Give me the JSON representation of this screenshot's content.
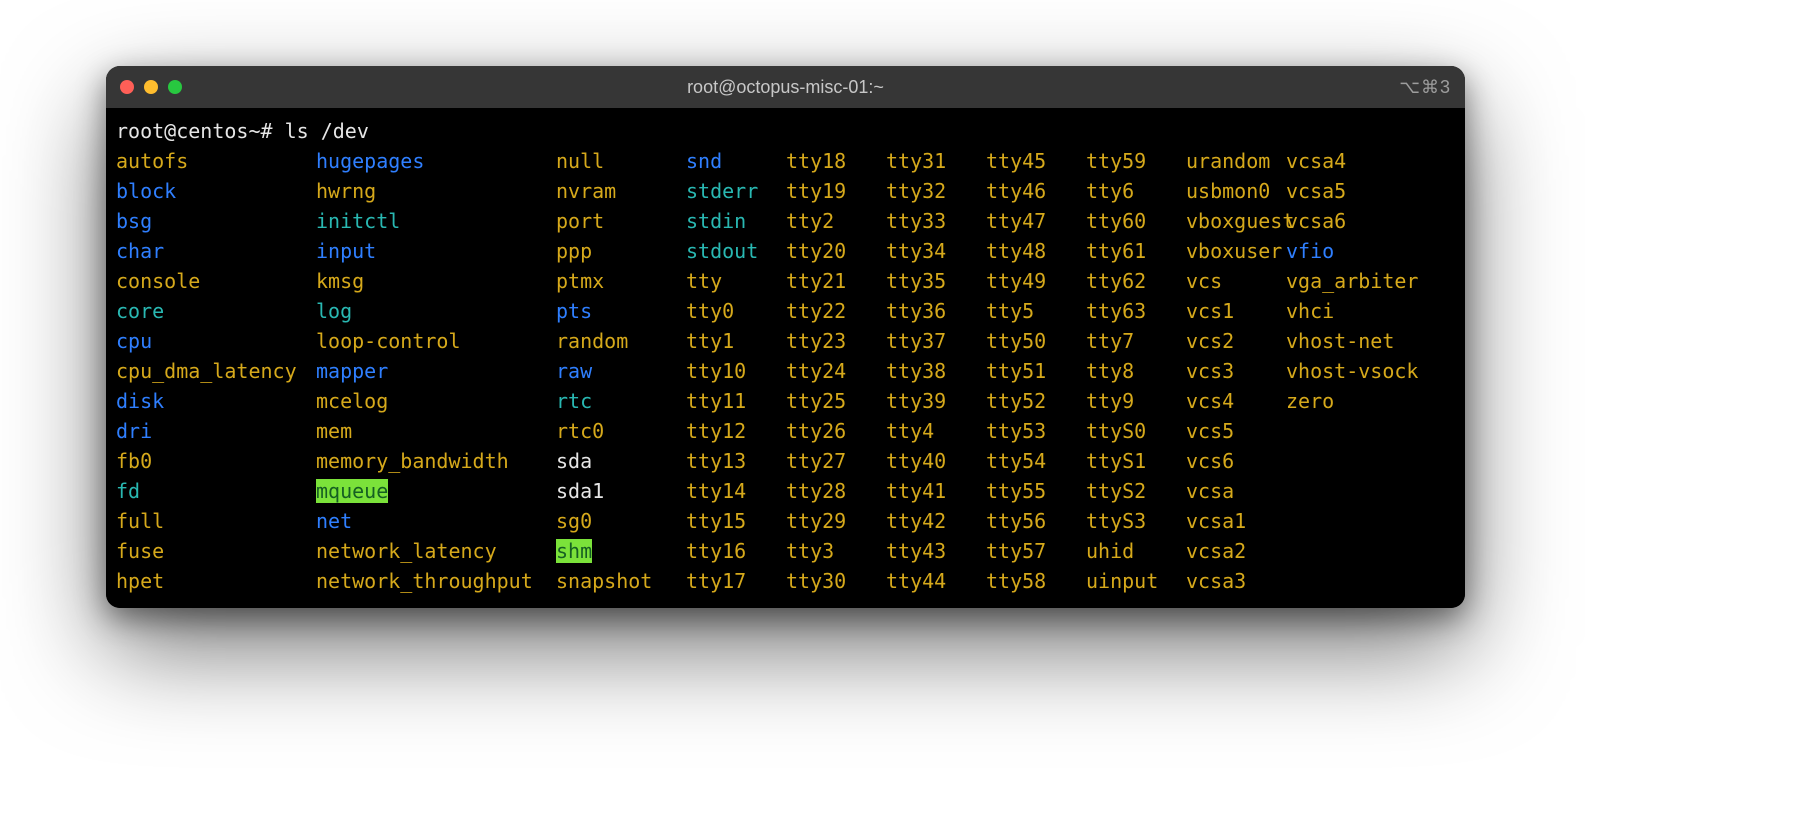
{
  "title": "root@octopus-misc-01:~",
  "title_right": "⌥⌘3",
  "prompt": "root@centos~# ls /dev",
  "columns": [
    [
      {
        "t": "autofs",
        "c": "yellow"
      },
      {
        "t": "block",
        "c": "blue"
      },
      {
        "t": "bsg",
        "c": "blue"
      },
      {
        "t": "char",
        "c": "blue"
      },
      {
        "t": "console",
        "c": "yellow"
      },
      {
        "t": "core",
        "c": "cyan"
      },
      {
        "t": "cpu",
        "c": "blue"
      },
      {
        "t": "cpu_dma_latency",
        "c": "yellow"
      },
      {
        "t": "disk",
        "c": "blue"
      },
      {
        "t": "dri",
        "c": "blue"
      },
      {
        "t": "fb0",
        "c": "yellow"
      },
      {
        "t": "fd",
        "c": "cyan"
      },
      {
        "t": "full",
        "c": "yellow"
      },
      {
        "t": "fuse",
        "c": "yellow"
      },
      {
        "t": "hpet",
        "c": "yellow"
      }
    ],
    [
      {
        "t": "hugepages",
        "c": "blue"
      },
      {
        "t": "hwrng",
        "c": "yellow"
      },
      {
        "t": "initctl",
        "c": "cyan"
      },
      {
        "t": "input",
        "c": "blue"
      },
      {
        "t": "kmsg",
        "c": "yellow"
      },
      {
        "t": "log",
        "c": "cyan"
      },
      {
        "t": "loop-control",
        "c": "yellow"
      },
      {
        "t": "mapper",
        "c": "blue"
      },
      {
        "t": "mcelog",
        "c": "yellow"
      },
      {
        "t": "mem",
        "c": "yellow"
      },
      {
        "t": "memory_bandwidth",
        "c": "yellow"
      },
      {
        "t": "mqueue",
        "c": "bgreen"
      },
      {
        "t": "net",
        "c": "blue"
      },
      {
        "t": "network_latency",
        "c": "yellow"
      },
      {
        "t": "network_throughput",
        "c": "yellow"
      }
    ],
    [
      {
        "t": "null",
        "c": "yellow"
      },
      {
        "t": "nvram",
        "c": "yellow"
      },
      {
        "t": "port",
        "c": "yellow"
      },
      {
        "t": "ppp",
        "c": "yellow"
      },
      {
        "t": "ptmx",
        "c": "yellow"
      },
      {
        "t": "pts",
        "c": "blue"
      },
      {
        "t": "random",
        "c": "yellow"
      },
      {
        "t": "raw",
        "c": "blue"
      },
      {
        "t": "rtc",
        "c": "cyan"
      },
      {
        "t": "rtc0",
        "c": "yellow"
      },
      {
        "t": "sda",
        "c": "white"
      },
      {
        "t": "sda1",
        "c": "white"
      },
      {
        "t": "sg0",
        "c": "yellow"
      },
      {
        "t": "shm",
        "c": "bgreen"
      },
      {
        "t": "snapshot",
        "c": "yellow"
      }
    ],
    [
      {
        "t": "snd",
        "c": "blue"
      },
      {
        "t": "stderr",
        "c": "cyan"
      },
      {
        "t": "stdin",
        "c": "cyan"
      },
      {
        "t": "stdout",
        "c": "cyan"
      },
      {
        "t": "tty",
        "c": "yellow"
      },
      {
        "t": "tty0",
        "c": "yellow"
      },
      {
        "t": "tty1",
        "c": "yellow"
      },
      {
        "t": "tty10",
        "c": "yellow"
      },
      {
        "t": "tty11",
        "c": "yellow"
      },
      {
        "t": "tty12",
        "c": "yellow"
      },
      {
        "t": "tty13",
        "c": "yellow"
      },
      {
        "t": "tty14",
        "c": "yellow"
      },
      {
        "t": "tty15",
        "c": "yellow"
      },
      {
        "t": "tty16",
        "c": "yellow"
      },
      {
        "t": "tty17",
        "c": "yellow"
      }
    ],
    [
      {
        "t": "tty18",
        "c": "yellow"
      },
      {
        "t": "tty19",
        "c": "yellow"
      },
      {
        "t": "tty2",
        "c": "yellow"
      },
      {
        "t": "tty20",
        "c": "yellow"
      },
      {
        "t": "tty21",
        "c": "yellow"
      },
      {
        "t": "tty22",
        "c": "yellow"
      },
      {
        "t": "tty23",
        "c": "yellow"
      },
      {
        "t": "tty24",
        "c": "yellow"
      },
      {
        "t": "tty25",
        "c": "yellow"
      },
      {
        "t": "tty26",
        "c": "yellow"
      },
      {
        "t": "tty27",
        "c": "yellow"
      },
      {
        "t": "tty28",
        "c": "yellow"
      },
      {
        "t": "tty29",
        "c": "yellow"
      },
      {
        "t": "tty3",
        "c": "yellow"
      },
      {
        "t": "tty30",
        "c": "yellow"
      }
    ],
    [
      {
        "t": "tty31",
        "c": "yellow"
      },
      {
        "t": "tty32",
        "c": "yellow"
      },
      {
        "t": "tty33",
        "c": "yellow"
      },
      {
        "t": "tty34",
        "c": "yellow"
      },
      {
        "t": "tty35",
        "c": "yellow"
      },
      {
        "t": "tty36",
        "c": "yellow"
      },
      {
        "t": "tty37",
        "c": "yellow"
      },
      {
        "t": "tty38",
        "c": "yellow"
      },
      {
        "t": "tty39",
        "c": "yellow"
      },
      {
        "t": "tty4",
        "c": "yellow"
      },
      {
        "t": "tty40",
        "c": "yellow"
      },
      {
        "t": "tty41",
        "c": "yellow"
      },
      {
        "t": "tty42",
        "c": "yellow"
      },
      {
        "t": "tty43",
        "c": "yellow"
      },
      {
        "t": "tty44",
        "c": "yellow"
      }
    ],
    [
      {
        "t": "tty45",
        "c": "yellow"
      },
      {
        "t": "tty46",
        "c": "yellow"
      },
      {
        "t": "tty47",
        "c": "yellow"
      },
      {
        "t": "tty48",
        "c": "yellow"
      },
      {
        "t": "tty49",
        "c": "yellow"
      },
      {
        "t": "tty5",
        "c": "yellow"
      },
      {
        "t": "tty50",
        "c": "yellow"
      },
      {
        "t": "tty51",
        "c": "yellow"
      },
      {
        "t": "tty52",
        "c": "yellow"
      },
      {
        "t": "tty53",
        "c": "yellow"
      },
      {
        "t": "tty54",
        "c": "yellow"
      },
      {
        "t": "tty55",
        "c": "yellow"
      },
      {
        "t": "tty56",
        "c": "yellow"
      },
      {
        "t": "tty57",
        "c": "yellow"
      },
      {
        "t": "tty58",
        "c": "yellow"
      }
    ],
    [
      {
        "t": "tty59",
        "c": "yellow"
      },
      {
        "t": "tty6",
        "c": "yellow"
      },
      {
        "t": "tty60",
        "c": "yellow"
      },
      {
        "t": "tty61",
        "c": "yellow"
      },
      {
        "t": "tty62",
        "c": "yellow"
      },
      {
        "t": "tty63",
        "c": "yellow"
      },
      {
        "t": "tty7",
        "c": "yellow"
      },
      {
        "t": "tty8",
        "c": "yellow"
      },
      {
        "t": "tty9",
        "c": "yellow"
      },
      {
        "t": "ttyS0",
        "c": "yellow"
      },
      {
        "t": "ttyS1",
        "c": "yellow"
      },
      {
        "t": "ttyS2",
        "c": "yellow"
      },
      {
        "t": "ttyS3",
        "c": "yellow"
      },
      {
        "t": "uhid",
        "c": "yellow"
      },
      {
        "t": "uinput",
        "c": "yellow"
      }
    ],
    [
      {
        "t": "urandom",
        "c": "yellow"
      },
      {
        "t": "usbmon0",
        "c": "yellow"
      },
      {
        "t": "vboxguest",
        "c": "yellow"
      },
      {
        "t": "vboxuser",
        "c": "yellow"
      },
      {
        "t": "vcs",
        "c": "yellow"
      },
      {
        "t": "vcs1",
        "c": "yellow"
      },
      {
        "t": "vcs2",
        "c": "yellow"
      },
      {
        "t": "vcs3",
        "c": "yellow"
      },
      {
        "t": "vcs4",
        "c": "yellow"
      },
      {
        "t": "vcs5",
        "c": "yellow"
      },
      {
        "t": "vcs6",
        "c": "yellow"
      },
      {
        "t": "vcsa",
        "c": "yellow"
      },
      {
        "t": "vcsa1",
        "c": "yellow"
      },
      {
        "t": "vcsa2",
        "c": "yellow"
      },
      {
        "t": "vcsa3",
        "c": "yellow"
      }
    ],
    [
      {
        "t": "vcsa4",
        "c": "yellow"
      },
      {
        "t": "vcsa5",
        "c": "yellow"
      },
      {
        "t": "vcsa6",
        "c": "yellow"
      },
      {
        "t": "vfio",
        "c": "blue"
      },
      {
        "t": "vga_arbiter",
        "c": "yellow"
      },
      {
        "t": "vhci",
        "c": "yellow"
      },
      {
        "t": "vhost-net",
        "c": "yellow"
      },
      {
        "t": "vhost-vsock",
        "c": "yellow"
      },
      {
        "t": "zero",
        "c": "yellow"
      }
    ]
  ]
}
